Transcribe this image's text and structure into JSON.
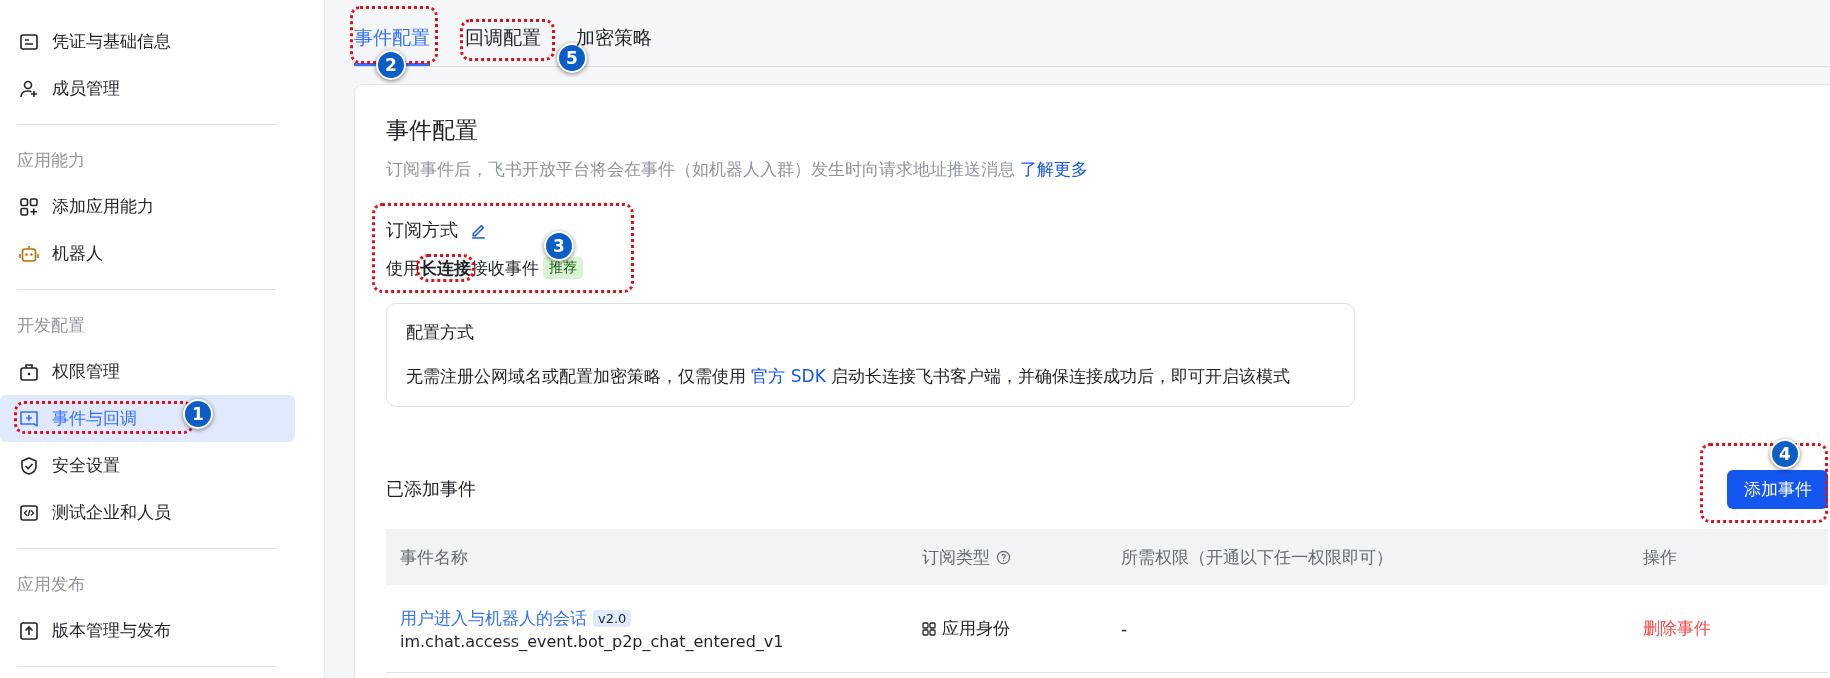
{
  "sidebar": {
    "sections": [
      {
        "items": [
          {
            "label": "凭证与基础信息",
            "selected": false
          },
          {
            "label": "成员管理",
            "selected": false
          }
        ]
      },
      {
        "title": "应用能力",
        "items": [
          {
            "label": "添加应用能力",
            "selected": false
          },
          {
            "label": "机器人",
            "selected": false
          }
        ]
      },
      {
        "title": "开发配置",
        "items": [
          {
            "label": "权限管理",
            "selected": false
          },
          {
            "label": "事件与回调",
            "selected": true,
            "annotation": "1"
          },
          {
            "label": "安全设置",
            "selected": false
          },
          {
            "label": "测试企业和人员",
            "selected": false
          }
        ]
      },
      {
        "title": "应用发布",
        "items": [
          {
            "label": "版本管理与发布",
            "selected": false
          }
        ]
      }
    ]
  },
  "tabs": [
    {
      "label": "事件配置",
      "selected": true,
      "annotation": "2"
    },
    {
      "label": "回调配置",
      "selected": false,
      "annotation": "5"
    },
    {
      "label": "加密策略",
      "selected": false
    }
  ],
  "event_config": {
    "title": "事件配置",
    "description": "订阅事件后，飞书开放平台将会在事件（如机器人入群）发生时向请求地址推送消息",
    "learn_more_link": "了解更多",
    "subscription": {
      "title": "订阅方式",
      "annotation": "3",
      "parts": [
        {
          "text": "使用",
          "bold": false,
          "outlined": false
        },
        {
          "text": "长连接",
          "bold": true,
          "outlined": true
        },
        {
          "text": "接收事件",
          "bold": false,
          "outlined": false
        }
      ],
      "tag": "推荐"
    },
    "config_box": {
      "title": "配置方式",
      "text_before": "无需注册公网域名或配置加密策略，仅需使用",
      "link": "官方 SDK",
      "text_after": "启动长连接飞书客户端，并确保连接成功后，即可开启该模式"
    }
  },
  "added_events": {
    "title": "已添加事件",
    "add_button": {
      "label": "添加事件",
      "annotation": "4"
    },
    "table": {
      "columns": [
        "事件名称",
        "订阅类型",
        "所需权限（开通以下任一权限即可）",
        "操作"
      ],
      "rows": [
        {
          "name": "用户进入与机器人的会话",
          "version": "v2.0",
          "code": "im.chat.access_event.bot_p2p_chat_entered_v1",
          "type": "应用身份",
          "permission": "-",
          "action": "删除事件"
        }
      ]
    }
  }
}
